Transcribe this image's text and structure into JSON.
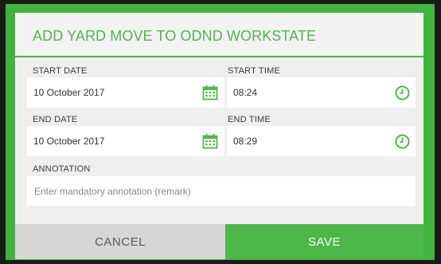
{
  "dialog": {
    "title": "ADD YARD MOVE TO ODND WORKSTATE",
    "start_date": {
      "label": "START DATE",
      "value": "10 October 2017",
      "icon": "calendar-icon"
    },
    "start_time": {
      "label": "START TIME",
      "value": "08:24",
      "icon": "clock-icon"
    },
    "end_date": {
      "label": "END DATE",
      "value": "10 October 2017",
      "icon": "calendar-icon"
    },
    "end_time": {
      "label": "END TIME",
      "value": "08:29",
      "icon": "clock-icon"
    },
    "annotation": {
      "label": "ANNOTATION",
      "value": "",
      "placeholder": "Enter mandatory annotation (remark)"
    },
    "cancel_label": "CANCEL",
    "save_label": "SAVE"
  },
  "colors": {
    "accent": "#4cb848",
    "background": "#efefef",
    "field": "#ffffff",
    "cancel_bg": "#d6d6d6"
  }
}
